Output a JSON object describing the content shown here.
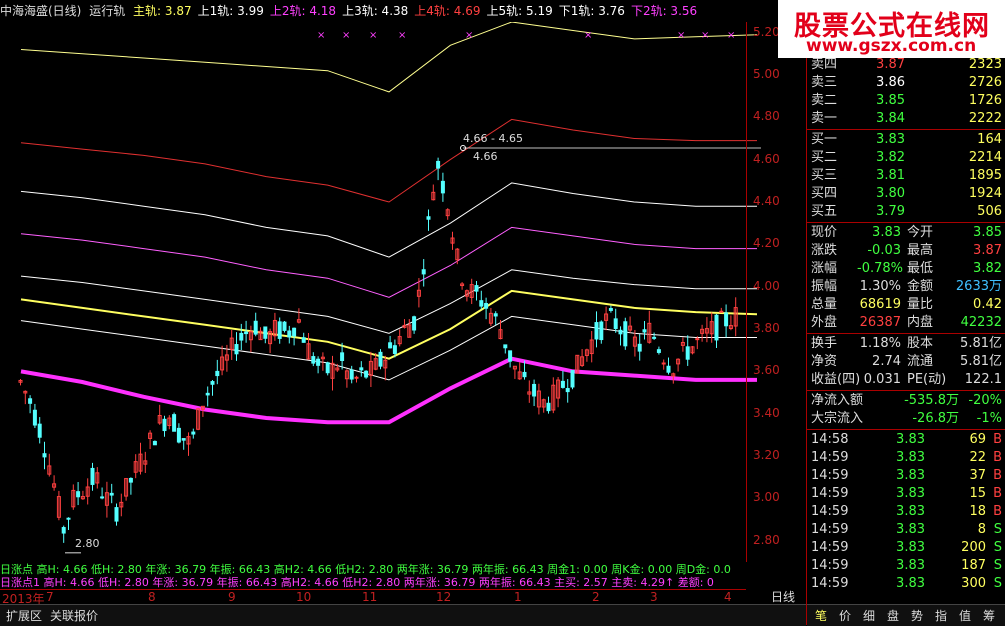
{
  "title": {
    "name": "中海海盛(日线)",
    "indicator": "运行轨",
    "items": [
      {
        "label": "主轨:",
        "value": "3.87",
        "color": "#ffff60"
      },
      {
        "label": "上1轨:",
        "value": "3.99",
        "color": "#ffffff"
      },
      {
        "label": "上2轨:",
        "value": "4.18",
        "color": "#ff40ff"
      },
      {
        "label": "上3轨:",
        "value": "4.38",
        "color": "#ffffff"
      },
      {
        "label": "上4轨:",
        "value": "4.69",
        "color": "#ff4040"
      },
      {
        "label": "上5轨:",
        "value": "5.19",
        "color": "#ffffff"
      },
      {
        "label": "下1轨:",
        "value": "3.76",
        "color": "#ffffff"
      },
      {
        "label": "下2轨:",
        "value": "3.56",
        "color": "#ff40ff"
      }
    ]
  },
  "chart_data": {
    "type": "line",
    "ylim": [
      2.7,
      5.25
    ],
    "y_ticks": [
      "5.20",
      "5.00",
      "4.80",
      "4.60",
      "4.40",
      "4.20",
      "4.00",
      "3.80",
      "3.60",
      "3.40",
      "3.20",
      "3.00",
      "2.80"
    ],
    "annotations": [
      "4.66 - 4.65",
      "4.66",
      "2.80"
    ],
    "x_labels": [
      "2013年",
      "7",
      "8",
      "9",
      "10",
      "11",
      "12",
      "1",
      "2",
      "3",
      "4"
    ],
    "series": [
      {
        "name": "上5轨",
        "color": "#ffff90",
        "values": [
          5.12,
          5.1,
          5.08,
          5.06,
          5.04,
          5.02,
          4.92,
          5.14,
          5.25,
          5.21,
          5.17,
          5.18,
          5.19
        ]
      },
      {
        "name": "上4轨",
        "color": "#e03030",
        "values": [
          4.68,
          4.65,
          4.62,
          4.58,
          4.52,
          4.48,
          4.4,
          4.6,
          4.79,
          4.74,
          4.7,
          4.69,
          4.69
        ]
      },
      {
        "name": "上3轨",
        "color": "#ffffff",
        "values": [
          4.45,
          4.42,
          4.38,
          4.34,
          4.28,
          4.24,
          4.14,
          4.3,
          4.49,
          4.44,
          4.4,
          4.38,
          4.38
        ]
      },
      {
        "name": "上2轨",
        "color": "#ff60ff",
        "values": [
          4.25,
          4.22,
          4.18,
          4.14,
          4.08,
          4.04,
          3.95,
          4.1,
          4.28,
          4.24,
          4.2,
          4.18,
          4.18
        ]
      },
      {
        "name": "上1轨",
        "color": "#ffffff",
        "values": [
          4.05,
          4.02,
          3.98,
          3.94,
          3.9,
          3.86,
          3.78,
          3.92,
          4.08,
          4.04,
          4.01,
          3.99,
          3.99
        ]
      },
      {
        "name": "主轨",
        "color": "#ffff60",
        "values": [
          3.94,
          3.9,
          3.86,
          3.82,
          3.78,
          3.74,
          3.66,
          3.8,
          3.98,
          3.94,
          3.9,
          3.88,
          3.87
        ]
      },
      {
        "name": "下1轨",
        "color": "#ffffff",
        "values": [
          3.84,
          3.8,
          3.76,
          3.72,
          3.68,
          3.64,
          3.56,
          3.7,
          3.86,
          3.82,
          3.78,
          3.76,
          3.76
        ]
      },
      {
        "name": "下2轨",
        "color": "#ff30ff",
        "values": [
          3.6,
          3.55,
          3.48,
          3.42,
          3.38,
          3.36,
          3.36,
          3.52,
          3.66,
          3.6,
          3.58,
          3.56,
          3.56
        ]
      }
    ]
  },
  "stats": {
    "line1": "日涨点 高H: 4.66 低H: 2.80 年涨: 36.79 年振: 66.43 高H2: 4.66 低H2: 2.80 两年涨: 36.79 两年振: 66.43 周金1: 0.00 周K金: 0.00 周D金: 0.0",
    "line2": "日涨点1 高H: 4.66 低H: 2.80 年涨: 36.79 年振: 66.43 高H2: 4.66 低H2: 2.80 两年涨: 36.79 两年振: 66.43 主买: 2.57 主卖: 4.29↑ 差额: 0"
  },
  "bottom_tabs": [
    "扩展区",
    "关联报价"
  ],
  "period": "日线",
  "logo": {
    "line1": "股票公式在线网",
    "line2": "www.gszx.com.cn"
  },
  "orderbook": {
    "asks": [
      {
        "label": "卖四",
        "price": "3.87",
        "vol": "2323"
      },
      {
        "label": "卖三",
        "price": "3.86",
        "vol": "2726"
      },
      {
        "label": "卖二",
        "price": "3.85",
        "vol": "1726"
      },
      {
        "label": "卖一",
        "price": "3.84",
        "vol": "2222"
      }
    ],
    "bids": [
      {
        "label": "买一",
        "price": "3.83",
        "vol": "164"
      },
      {
        "label": "买二",
        "price": "3.82",
        "vol": "2214"
      },
      {
        "label": "买三",
        "price": "3.81",
        "vol": "1895"
      },
      {
        "label": "买四",
        "price": "3.80",
        "vol": "1924"
      },
      {
        "label": "买五",
        "price": "3.79",
        "vol": "506"
      }
    ]
  },
  "quote": [
    {
      "l1": "现价",
      "v1": "3.83",
      "c1": "#40ff40",
      "l2": "今开",
      "v2": "3.85",
      "c2": "#40ff40"
    },
    {
      "l1": "涨跌",
      "v1": "-0.03",
      "c1": "#40ff40",
      "l2": "最高",
      "v2": "3.87",
      "c2": "#ff4040"
    },
    {
      "l1": "涨幅",
      "v1": "-0.78%",
      "c1": "#40ff40",
      "l2": "最低",
      "v2": "3.82",
      "c2": "#40ff40"
    },
    {
      "l1": "振幅",
      "v1": "1.30%",
      "c1": "#dddddd",
      "l2": "金额",
      "v2": "2633万",
      "c2": "#40c0ff"
    },
    {
      "l1": "总量",
      "v1": "68619",
      "c1": "#ffff60",
      "l2": "量比",
      "v2": "0.42",
      "c2": "#ffff60"
    },
    {
      "l1": "外盘",
      "v1": "26387",
      "c1": "#ff4040",
      "l2": "内盘",
      "v2": "42232",
      "c2": "#40ff40"
    }
  ],
  "quote2": [
    {
      "l1": "换手",
      "v1": "1.18%",
      "c1": "#dddddd",
      "l2": "股本",
      "v2": "5.81亿",
      "c2": "#dddddd"
    },
    {
      "l1": "净资",
      "v1": "2.74",
      "c1": "#dddddd",
      "l2": "流通",
      "v2": "5.81亿",
      "c2": "#dddddd"
    },
    {
      "l1": "收益(四)",
      "v1": "0.031",
      "c1": "#dddddd",
      "l2": "PE(动)",
      "v2": "122.1",
      "c2": "#dddddd"
    }
  ],
  "flows": [
    {
      "label": "净流入额",
      "v1": "-535.8万",
      "v2": "-20%"
    },
    {
      "label": "大宗流入",
      "v1": "-26.8万",
      "v2": "-1%"
    }
  ],
  "ticks": [
    {
      "time": "14:58",
      "price": "3.83",
      "vol": "69",
      "side": "B"
    },
    {
      "time": "14:59",
      "price": "3.83",
      "vol": "22",
      "side": "B"
    },
    {
      "time": "14:59",
      "price": "3.83",
      "vol": "37",
      "side": "B"
    },
    {
      "time": "14:59",
      "price": "3.83",
      "vol": "15",
      "side": "B"
    },
    {
      "time": "14:59",
      "price": "3.83",
      "vol": "18",
      "side": "B"
    },
    {
      "time": "14:59",
      "price": "3.83",
      "vol": "8",
      "side": "S"
    },
    {
      "time": "14:59",
      "price": "3.83",
      "vol": "200",
      "side": "S"
    },
    {
      "time": "14:59",
      "price": "3.83",
      "vol": "187",
      "side": "S"
    },
    {
      "time": "14:59",
      "price": "3.83",
      "vol": "300",
      "side": "S"
    }
  ],
  "right_tabs": [
    "笔",
    "价",
    "细",
    "盘",
    "势",
    "指",
    "值",
    "筹"
  ]
}
